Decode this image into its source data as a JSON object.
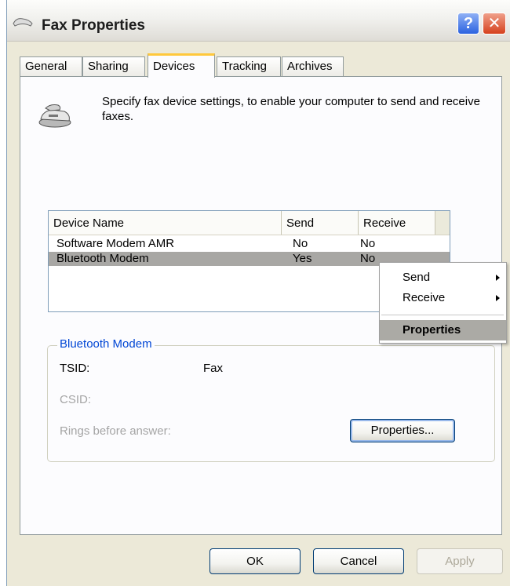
{
  "window": {
    "title": "Fax Properties",
    "help_label": "?",
    "close_label": "✕"
  },
  "tabs": [
    {
      "label": "General",
      "active": false
    },
    {
      "label": "Sharing",
      "active": false
    },
    {
      "label": "Devices",
      "active": true
    },
    {
      "label": "Tracking",
      "active": false
    },
    {
      "label": "Archives",
      "active": false
    }
  ],
  "devices_tab": {
    "intro_text": "Specify fax device settings, to enable your computer to send and receive faxes.",
    "icon": "fax-machine-icon",
    "columns": [
      "Device Name",
      "Send",
      "Receive"
    ],
    "rows": [
      {
        "name": "Software Modem AMR",
        "send": "No",
        "receive": "No",
        "selected": false
      },
      {
        "name": "Bluetooth Modem",
        "send": "Yes",
        "receive": "No",
        "selected": true
      }
    ],
    "group": {
      "title": "Bluetooth Modem",
      "tsid_label": "TSID:",
      "tsid_value": "Fax",
      "csid_label": "CSID:",
      "rings_label": "Rings before answer:",
      "properties_button": "Properties..."
    }
  },
  "context_menu": {
    "items": [
      {
        "label": "Send",
        "submenu": true
      },
      {
        "label": "Receive",
        "submenu": true
      },
      {
        "label": "Properties",
        "submenu": false,
        "highlighted": true
      }
    ]
  },
  "footer": {
    "ok": "OK",
    "cancel": "Cancel",
    "apply": "Apply"
  },
  "colors": {
    "window_bg": "#ece9d8",
    "group_title": "#0046d5",
    "selection": "#a8a7a4",
    "active_tab_accent": "#ffc83c"
  }
}
